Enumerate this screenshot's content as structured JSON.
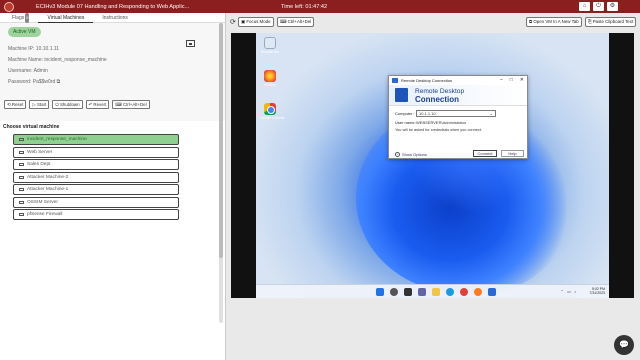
{
  "header": {
    "course_title": "ECIHv3 Module 07 Handling and Responding to Web Applic...",
    "time_left": "Time left: 01:47:42"
  },
  "tabs": [
    {
      "label": "Flags",
      "badge": "0"
    },
    {
      "label": "Virtual Machines"
    },
    {
      "label": "Instructions"
    }
  ],
  "vm_info": {
    "status_badge": "Active VM",
    "machine_ip": "Machine IP: 10.10.1.11",
    "machine_name": "Machine Name: incident_response_machine",
    "username": "Username: Admin",
    "password": "Password: Pa$$w0rd"
  },
  "vm_actions": [
    "Reset",
    "Start",
    "Shutdown",
    "Revert",
    "Ctrl+Alt+Del"
  ],
  "choose_title": "Choose virtual machine",
  "vm_list": [
    "incident_response_machine",
    "Web Server",
    "Sales Dept",
    "Attacker Machine-2",
    "Attacker Machine-1",
    "OSSIM Server",
    "pfSense Firewall"
  ],
  "toolbar": {
    "focus_mode": "Focus Mode",
    "ctrl_alt_del": "Ctrl+Alt+Del",
    "open_vm": "Open VM In A New Tab",
    "paste_clipboard": "Paste Clipboard Text"
  },
  "desktop_icons": [
    "Recycle Bin",
    "Firefox",
    "Google Chrome"
  ],
  "rdc": {
    "window_title": "Remote Desktop Connection",
    "header_line1": "Remote Desktop",
    "header_line2": "Connection",
    "computer_label": "Computer:",
    "computer_value": "10.1.1.10",
    "user_label": "User name:",
    "user_value": "WEBSERVER\\Administrator",
    "note": "You will be asked for credentials when you connect.",
    "show_options": "Show Options",
    "connect": "Connect",
    "help": "Help"
  },
  "taskbar": {
    "time": "5:02 PM",
    "date": "7/31/2023"
  }
}
